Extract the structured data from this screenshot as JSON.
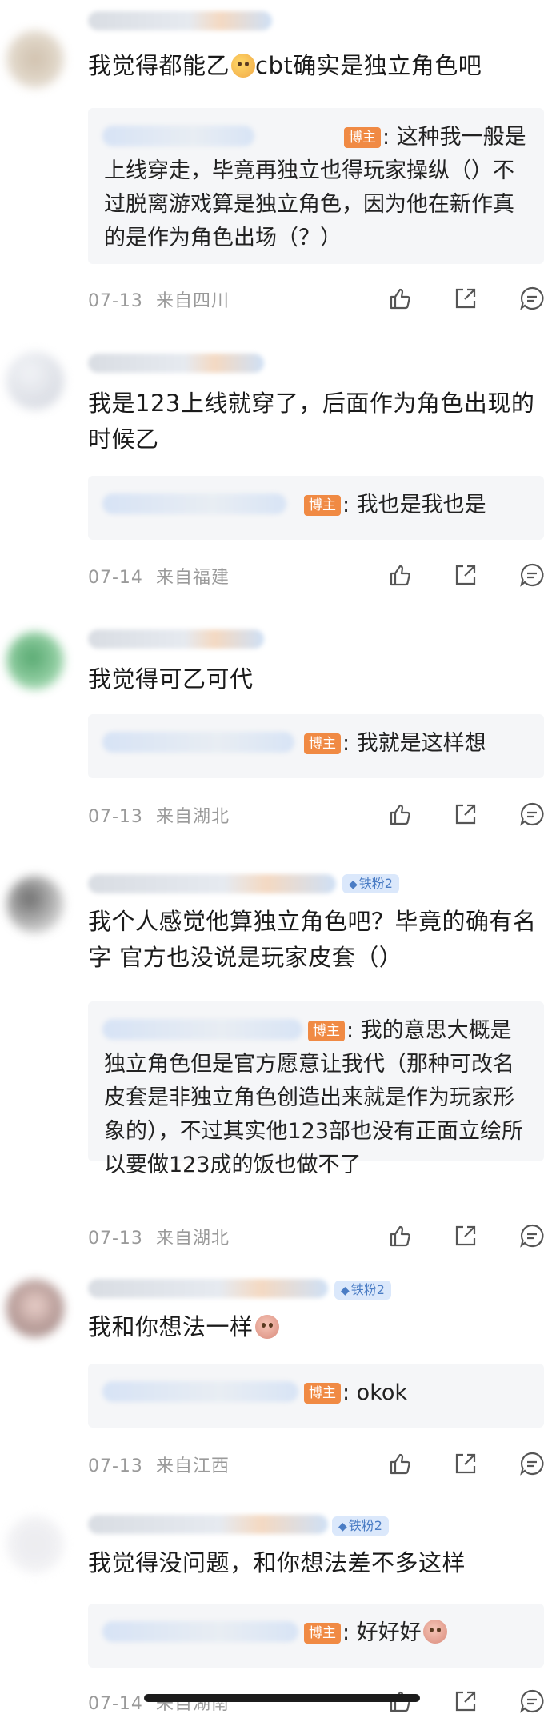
{
  "comments": [
    {
      "text": "我觉得都能乙",
      "text_after": "cbt确实是独立角色吧",
      "emoji": "thinking-face",
      "reply_prefix": "",
      "host_label": "博主",
      "reply": ": 这种我一般是上线穿走，毕竟再独立也得玩家操纵（）不过脱离游戏算是独立角色，因为他在新作真的是作为角色出场（？）",
      "date": "07-13",
      "location": "来自四川"
    },
    {
      "text": "我是123上线就穿了，后面作为角色出现的时候乙",
      "reply_prefix": "",
      "host_label": "博主",
      "reply": ": 我也是我也是",
      "date": "07-14",
      "location": "来自福建"
    },
    {
      "text": "我觉得可乙可代",
      "host_label": "博主",
      "reply": ": 我就是这样想",
      "date": "07-13",
      "location": "来自湖北"
    },
    {
      "text": "我个人感觉他算独立角色吧？毕竟的确有名字 官方也没说是玩家皮套（）",
      "badge": "铁粉2",
      "host_label": "博主",
      "reply": ": 我的意思大概是独立角色但是官方愿意让我代（那种可改名皮套是非独立角色创造出来就是作为玩家形象的），不过其实他123部也没有正面立绘所以要做123成的饭也做不了",
      "date": "07-13",
      "location": "来自湖北"
    },
    {
      "text": "我和你想法一样",
      "emoji": "shy-face",
      "badge": "铁粉2",
      "host_label": "博主",
      "reply": ": okok",
      "date": "07-13",
      "location": "来自江西"
    },
    {
      "text": "我觉得没问题，和你想法差不多这样",
      "badge": "铁粉2",
      "host_label": "博主",
      "reply": ": 好好好",
      "reply_emoji": "shy-face",
      "date": "07-14",
      "location": "来自湖南"
    }
  ],
  "icons": [
    "like-icon",
    "share-icon",
    "reply-icon"
  ],
  "colors": {
    "host_badge": "#f08a44",
    "fan_badge": "#dbe8fb",
    "meta": "#9a9a9a",
    "reply_bg": "#f5f6f8"
  }
}
